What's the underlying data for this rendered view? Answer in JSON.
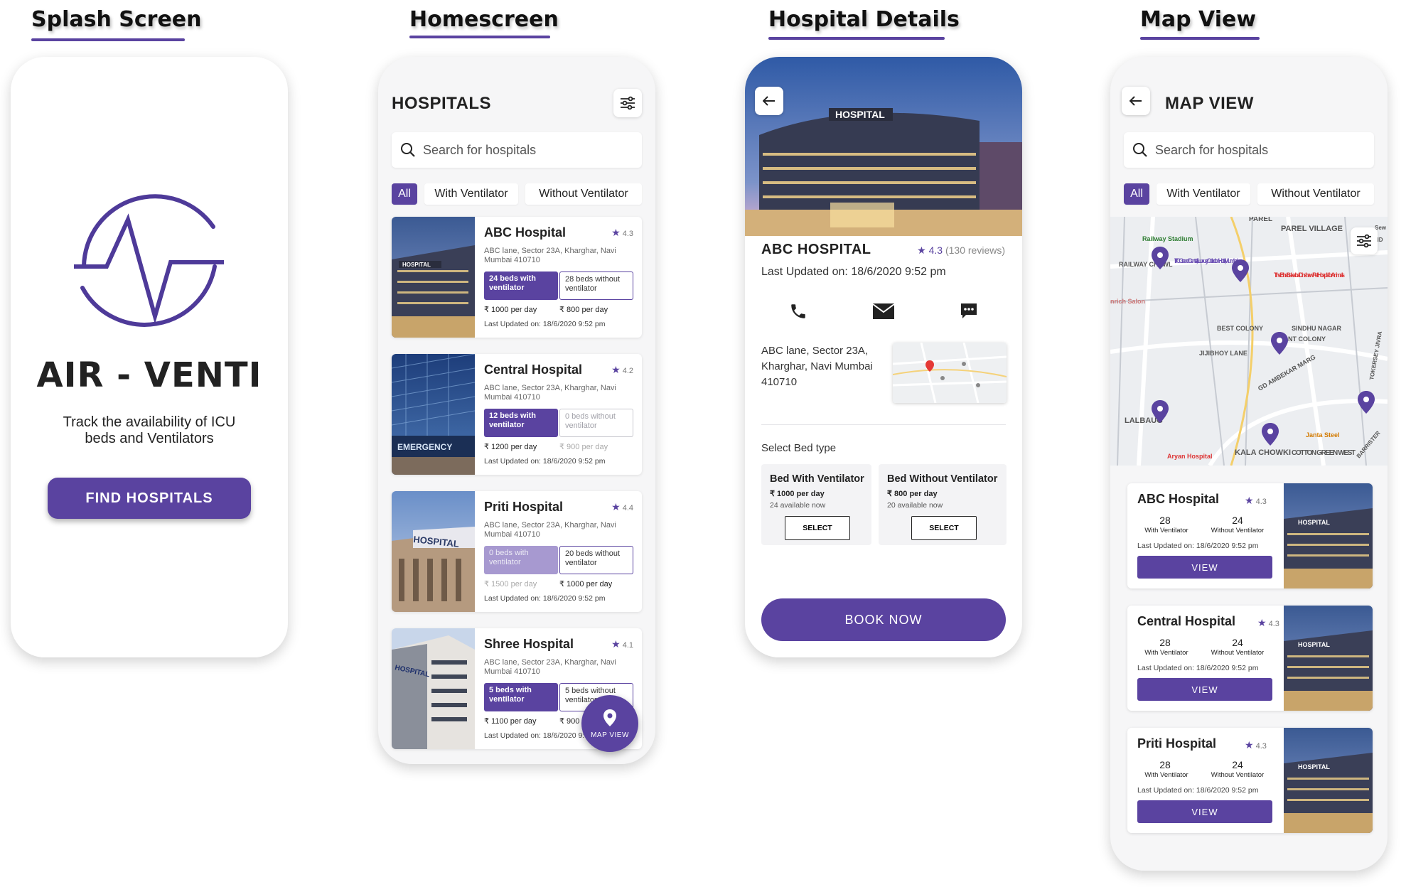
{
  "sections": {
    "splash": "Splash Screen",
    "home": "Homescreen",
    "details": "Hospital Details",
    "map": "Map View"
  },
  "splash": {
    "app_name": "AIR - VENTI",
    "tagline": "Track the availability of ICU beds and Ventilators",
    "cta": "FIND HOSPITALS"
  },
  "home": {
    "title": "HOSPITALS",
    "search_placeholder": "Search for hospitals",
    "filters": [
      "All",
      "With Ventilator",
      "Without Ventilator"
    ],
    "hospitals": [
      {
        "name": "ABC Hospital",
        "rating": "4.3",
        "address": "ABC lane, Sector 23A, Kharghar, Navi Mumbai 410710",
        "with_vent": "24 beds with ventilator",
        "without_vent": "28 beds without ventilator",
        "price_with": "₹ 1000 per day",
        "price_without": "₹ 800 per day",
        "updated": "Last Updated on: 18/6/2020 9:52 pm"
      },
      {
        "name": "Central Hospital",
        "rating": "4.2",
        "address": "ABC lane, Sector 23A, Kharghar, Navi Mumbai 410710",
        "with_vent": "12 beds with ventilator",
        "without_vent": "0 beds without ventilator",
        "price_with": "₹ 1200 per day",
        "price_without": "₹ 900 per day",
        "updated": "Last Updated on: 18/6/2020 9:52 pm"
      },
      {
        "name": "Priti Hospital",
        "rating": "4.4",
        "address": "ABC lane, Sector 23A, Kharghar, Navi Mumbai 410710",
        "with_vent": "0 beds with ventilator",
        "without_vent": "20 beds without ventilator",
        "price_with": "₹ 1500 per day",
        "price_without": "₹ 1000 per day",
        "updated": "Last Updated on: 18/6/2020 9:52 pm"
      },
      {
        "name": "Shree Hospital",
        "rating": "4.1",
        "address": "ABC lane, Sector 23A, Kharghar, Navi Mumbai 410710",
        "with_vent": "5 beds with ventilator",
        "without_vent": "5 beds without ventilator",
        "price_with": "₹ 1100 per day",
        "price_without": "₹ 900 per day",
        "updated": "Last Updated on: 18/6/2020 9:52 pm"
      }
    ],
    "map_fab": "MAP VIEW"
  },
  "details": {
    "hero_sign": "HOSPITAL",
    "title": "ABC HOSPITAL",
    "rating": "4.3",
    "reviews": "(130 reviews)",
    "updated": "Last Updated on: 18/6/2020 9:52 pm",
    "address": "ABC lane, Sector 23A, Kharghar, Navi Mumbai 410710",
    "select_label": "Select Bed type",
    "bed_types": [
      {
        "name": "Bed With Ventilator",
        "price": "₹ 1000 per day",
        "available": "24 available now",
        "action": "SELECT"
      },
      {
        "name": "Bed Without Ventilator",
        "price": "₹ 800 per day",
        "available": "20 available now",
        "action": "SELECT"
      }
    ],
    "cta": "BOOK NOW"
  },
  "mapview": {
    "title": "MAP VIEW",
    "search_placeholder": "Search for hospitals",
    "filters": [
      "All",
      "With Ventilator",
      "Without Ventilator"
    ],
    "map_labels": [
      "PAREL",
      "PAREL VILLAGE",
      "Railway Stadium",
      "ITC Grand Central, a Luxury Collection Hotel, Mumbai",
      "The Bhai Sakarbai Dinshaw Petit Hospital for Animals",
      "RAILWAY CHAWL",
      "nrich Salon",
      "BEST COLONY",
      "SINDHU NAGAR",
      "NT COLONY",
      "JIJIBHOY LANE",
      "GD AMBEKAR MARG",
      "LALBAUG",
      "Janta Steel",
      "Aryan Hospital",
      "KALA CHOWKI",
      "COTTON GREEN WEST",
      "TOKERSEY JIVRA",
      "BARRISTER",
      "Sew",
      "ND"
    ],
    "cards": [
      {
        "name": "ABC Hospital",
        "rating": "4.3",
        "with_count": "28",
        "with_label": "With Ventilator",
        "without_count": "24",
        "without_label": "Without Ventilator",
        "updated": "Last Updated on: 18/6/2020 9:52 pm",
        "action": "VIEW"
      },
      {
        "name": "Central Hospital",
        "rating": "4.3",
        "with_count": "28",
        "with_label": "With Ventilator",
        "without_count": "24",
        "without_label": "Without Ventilator",
        "updated": "Last Updated on: 18/6/2020 9:52 pm",
        "action": "VIEW"
      },
      {
        "name": "Priti Hospital",
        "rating": "4.3",
        "with_count": "28",
        "with_label": "With Ventilator",
        "without_count": "24",
        "without_label": "Without Ventilator",
        "updated": "Last Updated on: 18/6/2020 9:52 pm",
        "action": "VIEW"
      }
    ]
  },
  "colors": {
    "primary": "#5a43a0",
    "background": "#f6f6f7",
    "disabled": "#a799d0"
  }
}
